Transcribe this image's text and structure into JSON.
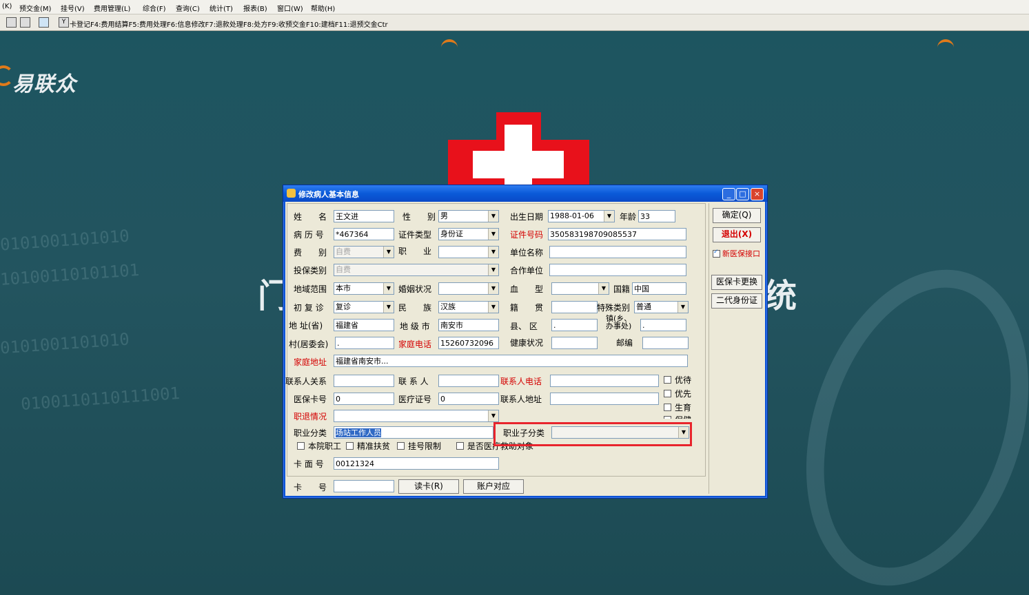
{
  "menubar": {
    "items": [
      "(K)",
      "预交金(M)",
      "挂号(V)",
      "费用管理(L)",
      "综合(F)",
      "查询(C)",
      "统计(T)",
      "报表(B)",
      "窗口(W)",
      "帮助(H)"
    ]
  },
  "toolbar": {
    "shortcuts": "卡登记F4:费用结算F5:费用处理F6:信息修改F7:退款处理F8:处方F9:收预交金F10:建档F11:退预交金Ctr",
    "icon_y": "Y"
  },
  "background": {
    "logo": "易联众",
    "big_left": "门",
    "big_right": "统",
    "binary": "0101001101010",
    "binary2": "10100110101101",
    "binary3": "0100110110111001"
  },
  "dialog": {
    "title": "修改病人基本信息",
    "fields": {
      "name_label": "姓　　名",
      "name_value": "王文进",
      "sex_label": "性　　别",
      "sex_value": "男",
      "dob_label": "出生日期",
      "dob_value": "1988-01-06",
      "age_label": "年龄",
      "age_value": "33",
      "record_label": "病 历 号",
      "record_value": "*467364",
      "idtype_label": "证件类型",
      "idtype_value": "身份证",
      "idno_label": "证件号码",
      "idno_value": "350583198709085537",
      "fee_label": "费　　别",
      "fee_value": "自费",
      "job_label": "职　　业",
      "job_value": "",
      "unit_label": "单位名称",
      "unit_value": "",
      "ins_label": "投保类别",
      "ins_value": "自费",
      "coop_label": "合作单位",
      "coop_value": "",
      "region_label": "地域范围",
      "region_value": "本市",
      "marital_label": "婚姻状况",
      "marital_value": "",
      "blood_label": "血　　型",
      "blood_value": "",
      "nation_label": "国籍",
      "nation_value": "中国",
      "visit_label": "初 复 诊",
      "visit_value": "复诊",
      "ethnic_label": "民　　族",
      "ethnic_value": "汉族",
      "native_label": "籍　　贯",
      "native_value": "",
      "special_label": "特殊类别",
      "special_value": "普通",
      "province_label": "地 址(省)",
      "province_value": "福建省",
      "city_label": "地 级 市",
      "city_value": "南安市",
      "county_label": "县、 区",
      "county_value": ".",
      "town_label_1": "镇(乡、",
      "town_label_2": "办事处)",
      "town_value": ".",
      "village_label": "村(居委会)",
      "village_value": ".",
      "phone_label": "家庭电话",
      "phone_value": "15260732096",
      "health_label": "健康状况",
      "health_value": "",
      "postcode_label": "邮编",
      "postcode_value": "",
      "address_label": "家庭地址",
      "address_value": "福建省南安市...",
      "contact_rel_label": "联系人关系",
      "contact_rel_value": "",
      "contact_label": "联 系 人",
      "contact_value": "",
      "contact_phone_label": "联系人电话",
      "contact_phone_value": "",
      "insure_card_label": "医保卡号",
      "insure_card_value": "0",
      "med_cert_label": "医疗证号",
      "med_cert_value": "0",
      "contact_addr_label": "联系人地址",
      "contact_addr_value": "",
      "retire_label": "职退情况",
      "retire_value": "",
      "job_cat_label": "职业分类",
      "job_cat_value": "场站工作人员",
      "job_subcat_label": "职业子分类",
      "job_subcat_value": "",
      "card_face_label": "卡 面 号",
      "card_face_value": "00121324",
      "card_no_label": "卡　　号",
      "card_no_value": ""
    },
    "checks": {
      "youdai": "优待",
      "youxian": "优先",
      "shengyu": "生育",
      "baojian": "保健",
      "staff": "本院职工",
      "poverty": "精准扶贫",
      "reg_limit": "挂号限制",
      "other": "是否医",
      "other_tail": "疗救助对象"
    },
    "buttons": {
      "ok": "确定(Q)",
      "exit": "退出(X)",
      "new_iface": "新医保接口",
      "change_card": "医保卡更换",
      "id2": "二代身份证",
      "read_card": "读卡(R)",
      "account": "账户对应"
    }
  }
}
